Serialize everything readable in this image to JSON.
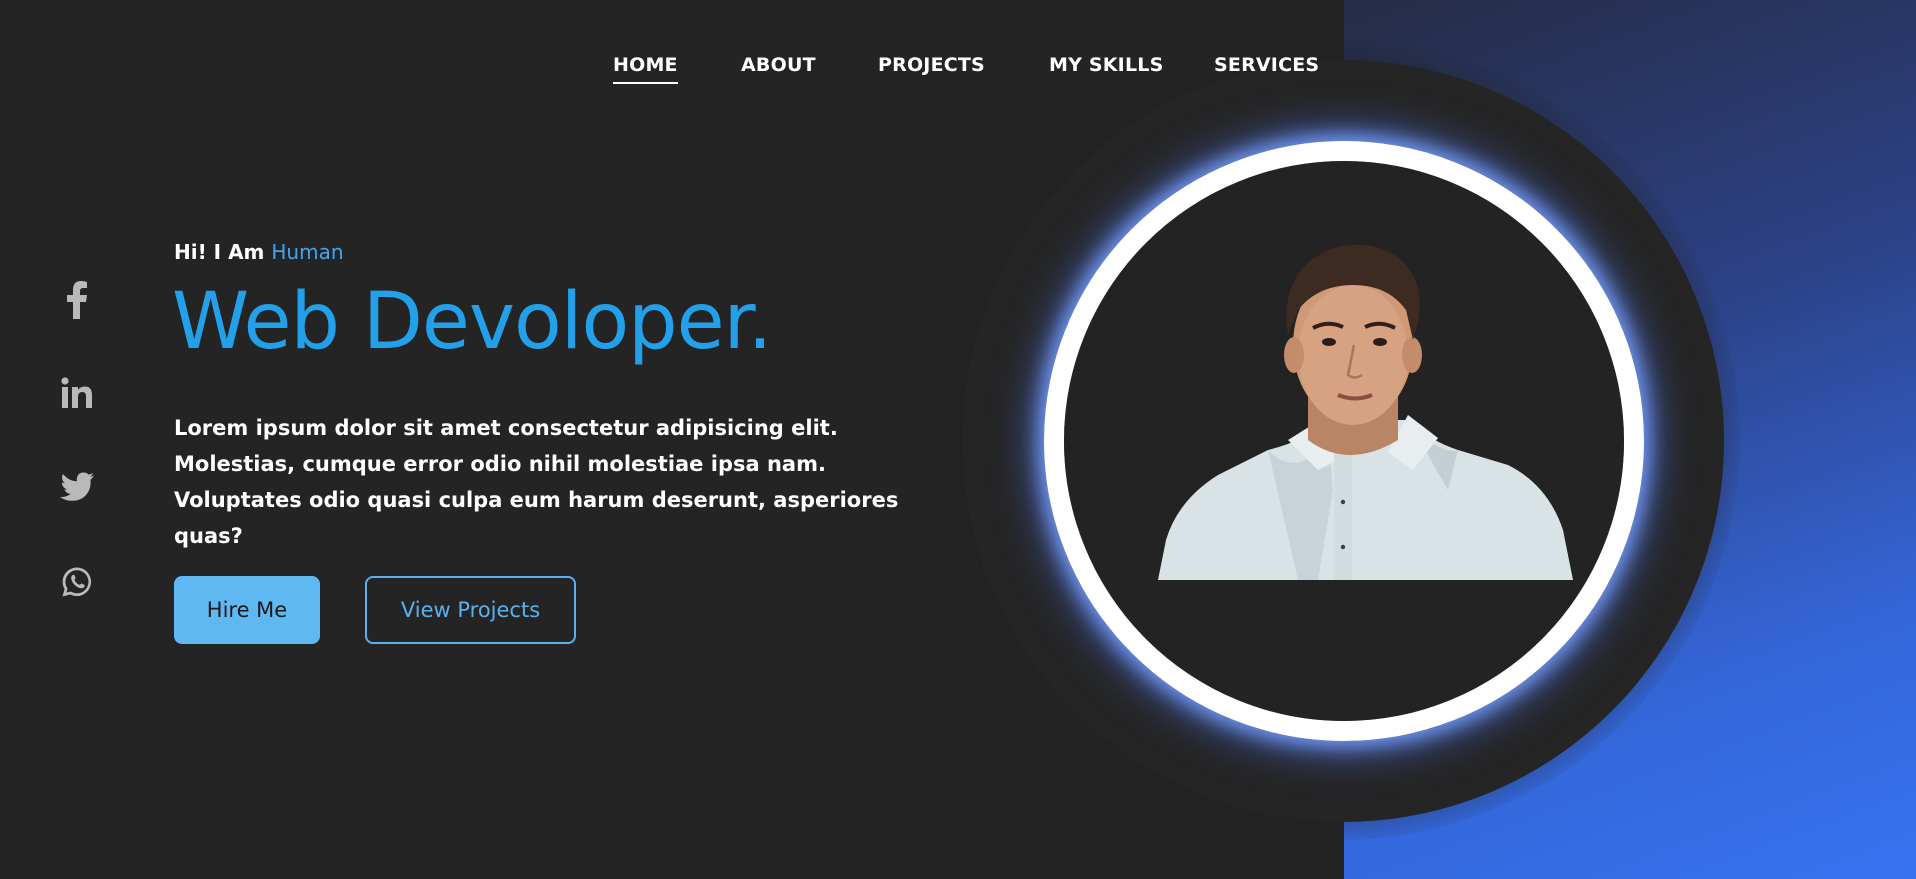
{
  "nav": {
    "items": [
      {
        "label": "HOME",
        "active": true
      },
      {
        "label": "ABOUT",
        "active": false
      },
      {
        "label": "PROJECTS",
        "active": false
      },
      {
        "label": "MY SKILLS",
        "active": false
      },
      {
        "label": "SERVICES",
        "active": false
      }
    ]
  },
  "social": [
    {
      "icon": "facebook-icon"
    },
    {
      "icon": "linkedin-icon"
    },
    {
      "icon": "twitter-icon"
    },
    {
      "icon": "whatsapp-icon"
    }
  ],
  "hero": {
    "greeting_prefix": "Hi! I Am ",
    "greeting_name": "Human",
    "headline": "Web Devoloper.",
    "description": "Lorem ipsum dolor sit amet consectetur adipisicing elit. Molestias, cumque error odio nihil molestiae ipsa nam. Voluptates odio quasi culpa eum harum deserunt, asperiores quas?",
    "hire_label": "Hire Me",
    "projects_label": "View Projects"
  },
  "colors": {
    "background": "#242424",
    "accent": "#23a0ea",
    "button": "#5fb8f2",
    "panel_gradient_end": "#3673f2"
  }
}
